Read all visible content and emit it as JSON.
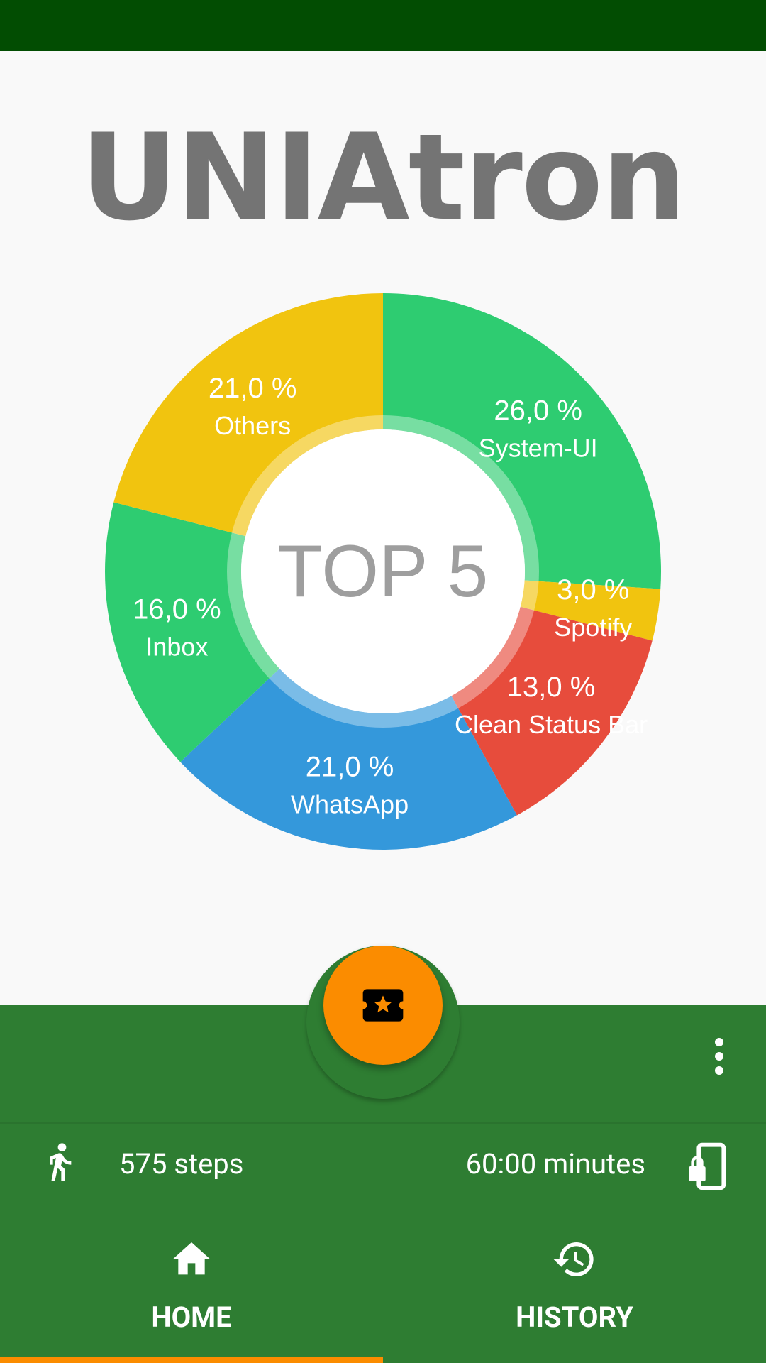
{
  "app": {
    "logo_text": "UNIAtron"
  },
  "colors": {
    "status_bar": "#024d02",
    "panel": "#2e7d32",
    "accent": "#fb8c00",
    "green": "#2ecc71",
    "yellow": "#f1c40f",
    "red": "#e74c3c",
    "blue": "#3498db"
  },
  "chart": {
    "center_label": "TOP 5"
  },
  "chart_data": {
    "type": "pie",
    "title": "TOP 5",
    "slices": [
      {
        "label": "System-UI",
        "value": 26.0,
        "display": "26,0 %",
        "color": "#2ecc71"
      },
      {
        "label": "Spotify",
        "value": 3.0,
        "display": "3,0 %",
        "color": "#f1c40f"
      },
      {
        "label": "Clean Status Bar",
        "value": 13.0,
        "display": "13,0 %",
        "color": "#e74c3c"
      },
      {
        "label": "WhatsApp",
        "value": 21.0,
        "display": "21,0 %",
        "color": "#3498db"
      },
      {
        "label": "Inbox",
        "value": 16.0,
        "display": "16,0 %",
        "color": "#2ecc71"
      },
      {
        "label": "Others",
        "value": 21.0,
        "display": "21,0 %",
        "color": "#f1c40f"
      }
    ]
  },
  "fab": {
    "icon": "ticket-star-icon"
  },
  "stats": {
    "steps": "575 steps",
    "steps_icon": "walk-icon",
    "minutes": "60:00 minutes",
    "minutes_icon": "phone-lock-icon"
  },
  "nav": {
    "home_label": "HOME",
    "home_icon": "home-icon",
    "history_label": "HISTORY",
    "history_icon": "history-icon",
    "active": "HOME"
  },
  "menu": {
    "icon": "more-vert-icon"
  }
}
